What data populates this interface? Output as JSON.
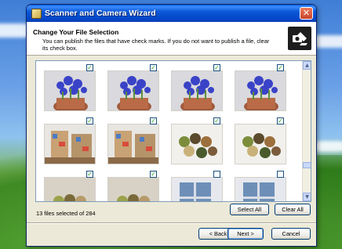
{
  "window": {
    "title": "Scanner and Camera Wizard",
    "close_glyph": "✕"
  },
  "header": {
    "heading": "Change Your File Selection",
    "description": "You can publish the files that have check marks.  If you do not want to publish a file, clear its check box.",
    "icon": "scanner-camera-wizard-icon"
  },
  "gallery": {
    "thumbnails": [
      {
        "subject": "iris-flowers-pot",
        "checked": true
      },
      {
        "subject": "iris-flowers-pot",
        "checked": true
      },
      {
        "subject": "iris-flowers-pot",
        "checked": true
      },
      {
        "subject": "iris-flowers-pot",
        "checked": true
      },
      {
        "subject": "toy-shelves-room",
        "checked": true
      },
      {
        "subject": "toy-shelves-room",
        "checked": true
      },
      {
        "subject": "balls-of-yarn",
        "checked": true
      },
      {
        "subject": "balls-of-yarn",
        "checked": true
      },
      {
        "subject": "yarn-on-table",
        "checked": true
      },
      {
        "subject": "yarn-on-table",
        "checked": true
      },
      {
        "subject": "window-room",
        "checked": false
      },
      {
        "subject": "window-room",
        "checked": false
      }
    ],
    "check_glyph": "✓",
    "scroll_up_glyph": "▲",
    "scroll_down_glyph": "▼"
  },
  "status": {
    "selection_text": "13 files selected of 284"
  },
  "buttons": {
    "select_all": "Select All",
    "clear_all": "Clear All",
    "back": "< Back",
    "next": "Next >",
    "cancel": "Cancel"
  },
  "colors": {
    "title_bar": "#0346c9",
    "dialog_face": "#ece9d8",
    "check_mark": "#21a121"
  }
}
